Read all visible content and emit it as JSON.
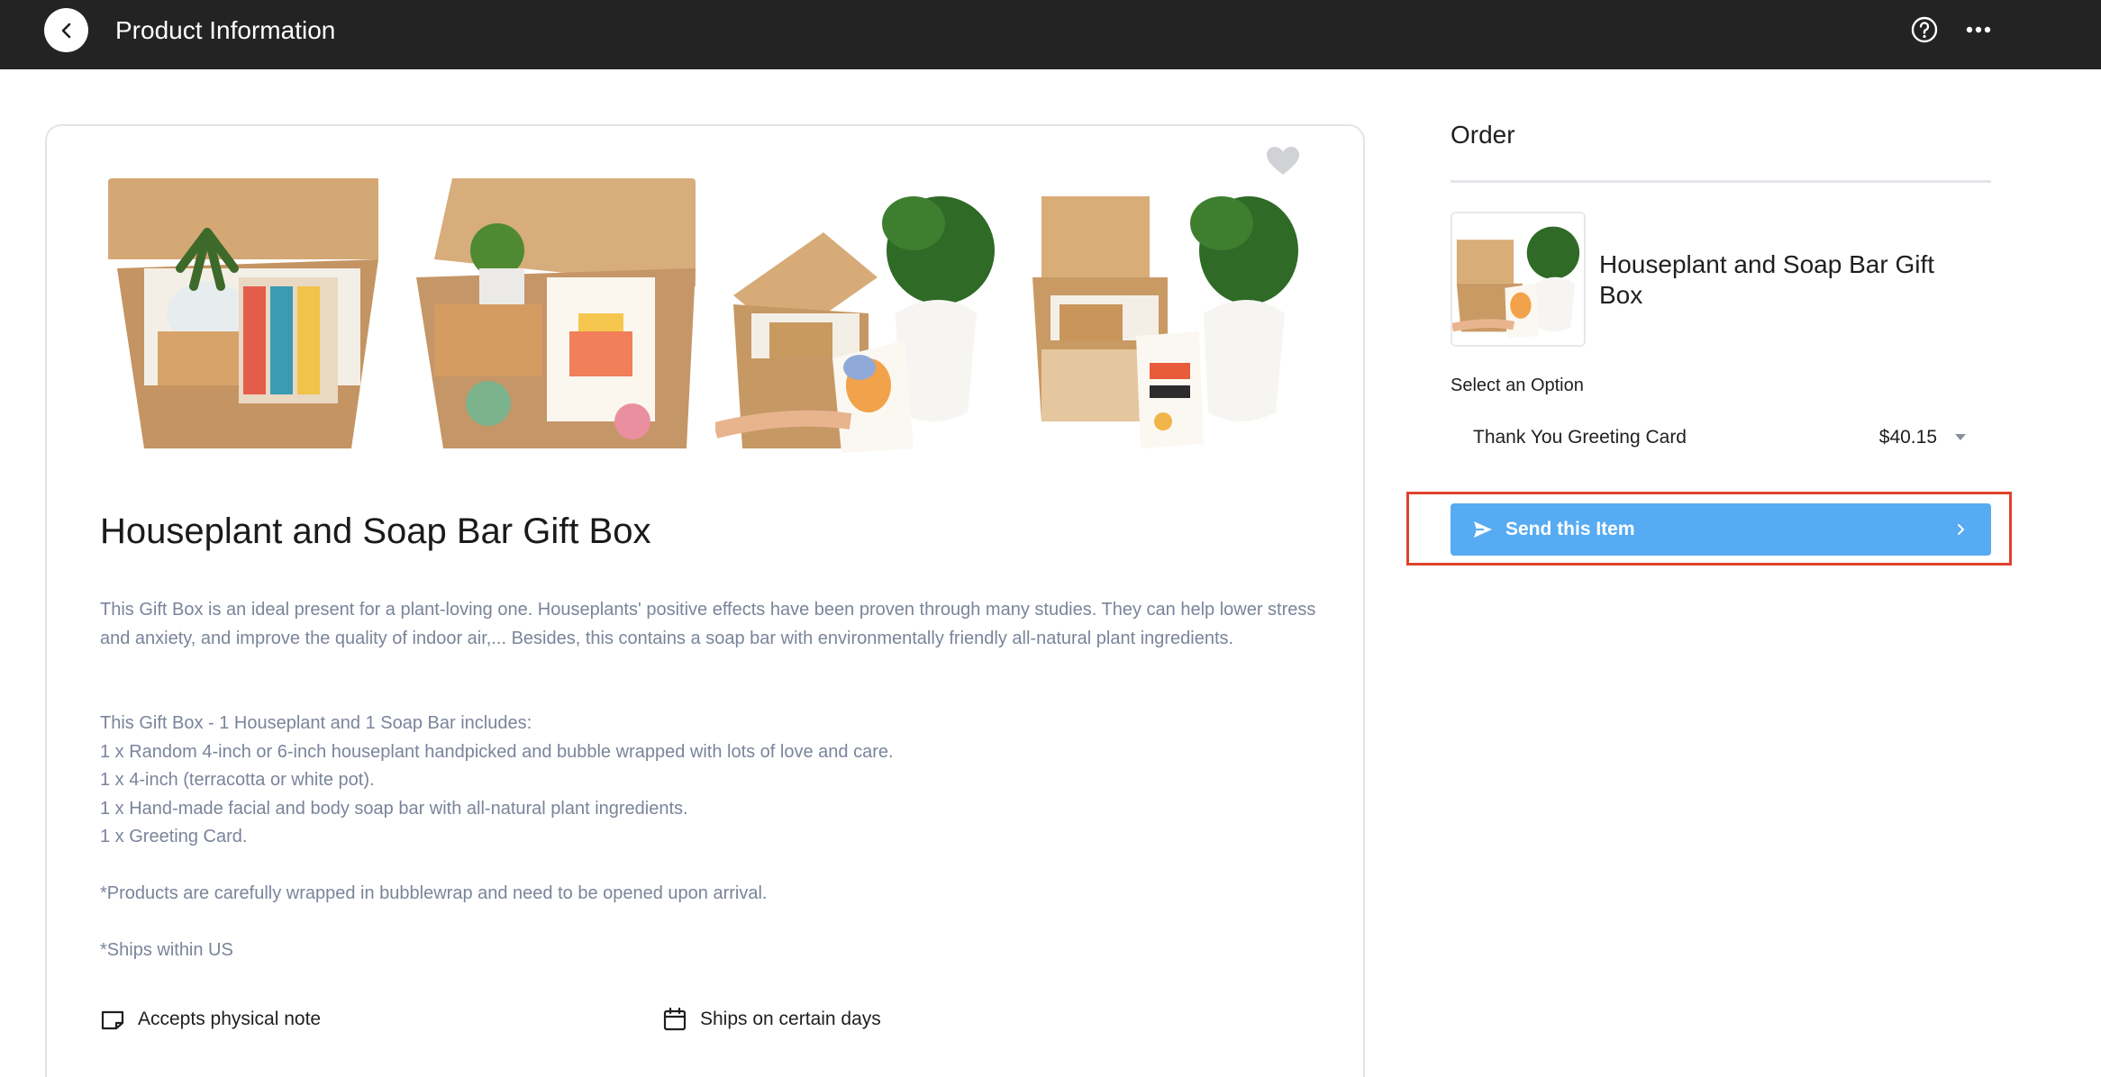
{
  "header": {
    "title": "Product Information"
  },
  "product": {
    "name": "Houseplant and Soap Bar Gift Box",
    "description": "This Gift Box is an ideal present for a plant-loving one. Houseplants' positive effects have been proven through many studies. They can help lower stress and anxiety, and improve the quality of indoor air,... Besides, this contains a soap bar with environmentally friendly all-natural plant ingredients.",
    "includes_heading": "This Gift Box - 1 Houseplant and 1 Soap Bar includes:",
    "includes": [
      "1 x Random 4-inch or 6-inch houseplant handpicked and bubble wrapped with lots of love and care.",
      "1 x 4-inch (terracotta or white pot).",
      "1 x Hand-made facial and body soap bar with all-natural plant ingredients.",
      "1 x Greeting Card."
    ],
    "note_wrapping": "*Products are carefully wrapped in bubblewrap and need to be opened upon arrival.",
    "note_shipping": "*Ships within US",
    "features": [
      {
        "label": "Accepts physical note",
        "icon": "note-icon"
      },
      {
        "label": "Ships on certain days",
        "icon": "calendar-icon"
      }
    ]
  },
  "order": {
    "title": "Order",
    "item_name": "Houseplant and Soap Bar Gift Box",
    "select_label": "Select an Option",
    "selected_option": "Thank You Greeting Card",
    "selected_price": "$40.15",
    "send_label": "Send this Item"
  },
  "colors": {
    "topbar": "#232323",
    "send_button": "#56abf2",
    "highlight": "#e0432d",
    "description_text": "#7a849a"
  }
}
